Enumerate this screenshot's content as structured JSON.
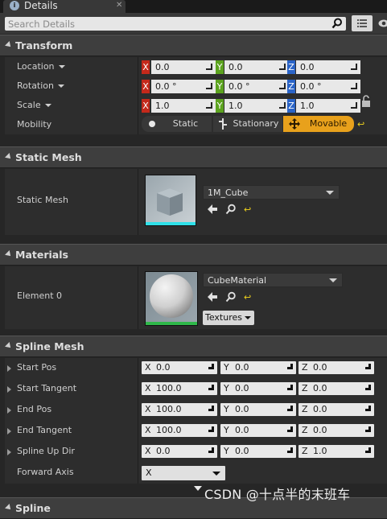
{
  "tab": {
    "label": "Details",
    "icon": "info-icon"
  },
  "search": {
    "placeholder": "Search Details"
  },
  "categories": {
    "transform": "Transform",
    "static_mesh": "Static Mesh",
    "materials": "Materials",
    "spline_mesh": "Spline Mesh",
    "spline": "Spline"
  },
  "transform": {
    "location": {
      "label": "Location",
      "x": "0.0",
      "y": "0.0",
      "z": "0.0"
    },
    "rotation": {
      "label": "Rotation",
      "x": "0.0 °",
      "y": "0.0 °",
      "z": "0.0 °"
    },
    "scale": {
      "label": "Scale",
      "x": "1.0",
      "y": "1.0",
      "z": "1.0"
    },
    "mobility": {
      "label": "Mobility",
      "options": [
        "Static",
        "Stationary",
        "Movable"
      ],
      "selected": "Movable"
    },
    "axis_labels": {
      "x": "X",
      "y": "Y",
      "z": "Z"
    }
  },
  "static_mesh": {
    "label": "Static Mesh",
    "asset": "1M_Cube"
  },
  "materials": {
    "label": "Element 0",
    "asset": "CubeMaterial",
    "textures_button": "Textures"
  },
  "spline_mesh": {
    "rows": [
      {
        "label": "Start Pos",
        "x": "0.0",
        "y": "0.0",
        "z": "0.0"
      },
      {
        "label": "Start Tangent",
        "x": "100.0",
        "y": "0.0",
        "z": "0.0"
      },
      {
        "label": "End Pos",
        "x": "100.0",
        "y": "0.0",
        "z": "0.0"
      },
      {
        "label": "End Tangent",
        "x": "100.0",
        "y": "0.0",
        "z": "0.0"
      },
      {
        "label": "Spline Up Dir",
        "x": "0.0",
        "y": "0.0",
        "z": "1.0"
      }
    ],
    "forward_axis": {
      "label": "Forward Axis",
      "value": "X"
    }
  },
  "watermark": "CSDN @十点半的末班车",
  "colors": {
    "x_axis": "#c4291b",
    "y_axis": "#5ca31f",
    "z_axis": "#2a64c8",
    "selected_mobility": "#e8a11c"
  }
}
